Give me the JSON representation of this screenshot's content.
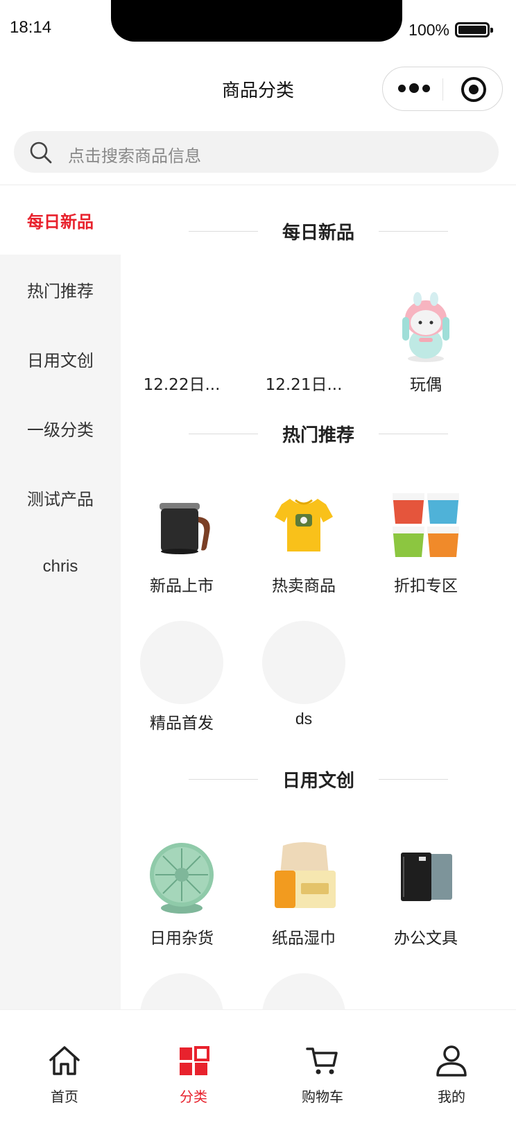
{
  "status_bar": {
    "time": "18:14",
    "battery": "100%"
  },
  "nav": {
    "title": "商品分类"
  },
  "search": {
    "placeholder": "点击搜索商品信息"
  },
  "sidebar": {
    "items": [
      {
        "label": "每日新品",
        "active": true
      },
      {
        "label": "热门推荐"
      },
      {
        "label": "日用文创"
      },
      {
        "label": "一级分类"
      },
      {
        "label": "测试产品"
      },
      {
        "label": "chris"
      }
    ]
  },
  "sections": [
    {
      "title": "每日新品",
      "items": [
        {
          "label": "12.22日...",
          "image": "none"
        },
        {
          "label": "12.21日...",
          "image": "none"
        },
        {
          "label": "玩偶",
          "image": "mascot-doll"
        }
      ]
    },
    {
      "title": "热门推荐",
      "items": [
        {
          "label": "新品上市",
          "image": "black-mug"
        },
        {
          "label": "热卖商品",
          "image": "yellow-tshirt"
        },
        {
          "label": "折扣专区",
          "image": "noodle-cups"
        },
        {
          "label": "精品首发",
          "image": "placeholder"
        },
        {
          "label": "ds",
          "image": "placeholder"
        }
      ]
    },
    {
      "title": "日用文创",
      "items": [
        {
          "label": "日用杂货",
          "image": "desk-fan"
        },
        {
          "label": "纸品湿巾",
          "image": "tissue-box"
        },
        {
          "label": "办公文具",
          "image": "notebooks"
        }
      ]
    }
  ],
  "tabbar": {
    "items": [
      {
        "label": "首页",
        "icon": "home-icon"
      },
      {
        "label": "分类",
        "icon": "category-icon",
        "active": true
      },
      {
        "label": "购物车",
        "icon": "cart-icon"
      },
      {
        "label": "我的",
        "icon": "user-icon"
      }
    ]
  },
  "colors": {
    "accent": "#e8222d",
    "sidebar_bg": "#f5f5f5",
    "search_bg": "#f2f2f2"
  }
}
